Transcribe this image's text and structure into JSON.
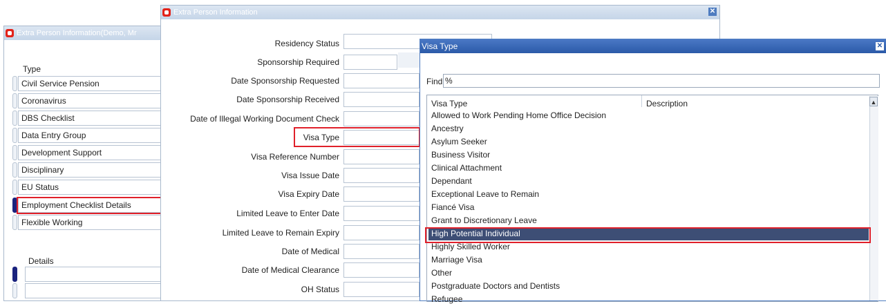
{
  "left_window": {
    "title": "Extra Person Information(Demo, Mr",
    "type_header": "Type",
    "types": [
      "Civil Service Pension",
      "Coronavirus",
      "DBS Checklist",
      "Data Entry Group",
      "Development Support",
      "Disciplinary",
      "EU Status",
      "Employment Checklist Details",
      "Flexible Working"
    ],
    "selected_type": "Employment Checklist Details",
    "details_header": "Details"
  },
  "middle_window": {
    "title": "Extra Person Information",
    "fields": [
      "Residency Status",
      "Sponsorship Required",
      "Date Sponsorship Requested",
      "Date Sponsorship Received",
      "Date of Illegal Working Document Check",
      "Visa Type",
      "Visa Reference Number",
      "Visa Issue Date",
      "Visa Expiry Date",
      "Limited Leave to Enter Date",
      "Limited Leave to Remain Expiry",
      "Date of Medical",
      "Date of Medical Clearance",
      "OH Status"
    ]
  },
  "visa_window": {
    "title": "Visa Type",
    "find_label": "Find",
    "find_value": "%",
    "columns": [
      "Visa Type",
      "Description"
    ],
    "rows": [
      "Allowed to Work Pending Home Office Decision",
      "Ancestry",
      "Asylum Seeker",
      "Business Visitor",
      "Clinical Attachment",
      "Dependant",
      "Exceptional Leave to Remain",
      "Fiancé Visa",
      "Grant to Discretionary Leave",
      "High Potential Individual",
      "Highly Skilled Worker",
      "Marriage Visa",
      "Other",
      "Postgraduate Doctors and Dentists",
      "Refugee"
    ],
    "selected_row": "High Potential Individual"
  },
  "colors": {
    "highlight_box": "#e0202a",
    "selection_bg": "#3d4e75",
    "title_blue": "#2b5aa8"
  }
}
